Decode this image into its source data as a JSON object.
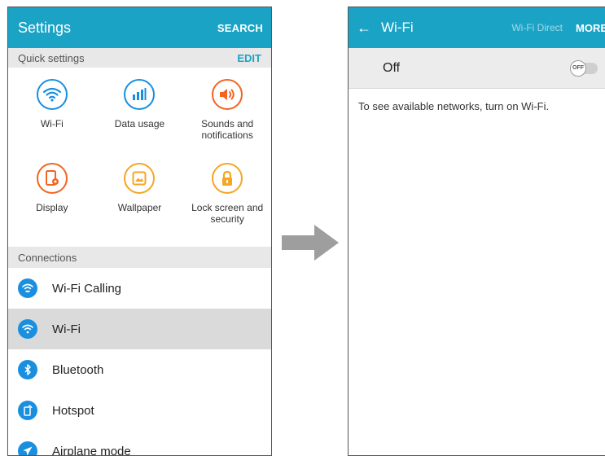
{
  "settings": {
    "title": "Settings",
    "search_label": "SEARCH",
    "quick_settings": {
      "header": "Quick settings",
      "edit_label": "EDIT",
      "items": [
        {
          "label": "Wi-Fi",
          "icon": "wifi-icon",
          "color": "#1a8fe0"
        },
        {
          "label": "Data usage",
          "icon": "data-usage-icon",
          "color": "#1a8fe0"
        },
        {
          "label": "Sounds and notifications",
          "icon": "sound-icon",
          "color": "#f26522"
        },
        {
          "label": "Display",
          "icon": "display-icon",
          "color": "#f26522"
        },
        {
          "label": "Wallpaper",
          "icon": "wallpaper-icon",
          "color": "#f5a623"
        },
        {
          "label": "Lock screen and security",
          "icon": "lock-icon",
          "color": "#f5a623"
        }
      ]
    },
    "connections": {
      "header": "Connections",
      "items": [
        {
          "label": "Wi-Fi Calling",
          "icon": "wifi-calling-icon"
        },
        {
          "label": "Wi-Fi",
          "icon": "wifi-icon",
          "selected": true
        },
        {
          "label": "Bluetooth",
          "icon": "bluetooth-icon"
        },
        {
          "label": "Hotspot",
          "icon": "hotspot-icon"
        },
        {
          "label": "Airplane mode",
          "icon": "airplane-icon"
        }
      ]
    }
  },
  "wifi": {
    "back_icon": "back-arrow-icon",
    "title": "Wi-Fi",
    "wifi_direct_label": "Wi-Fi Direct",
    "more_label": "MORE",
    "status_label": "Off",
    "toggle_text": "OFF",
    "hint": "To see available networks, turn on Wi-Fi."
  },
  "colors": {
    "appbar": "#1ba3c6",
    "accent": "#1ba3c6",
    "connection_icon": "#1a8fe0",
    "arrow": "#9e9e9e"
  }
}
